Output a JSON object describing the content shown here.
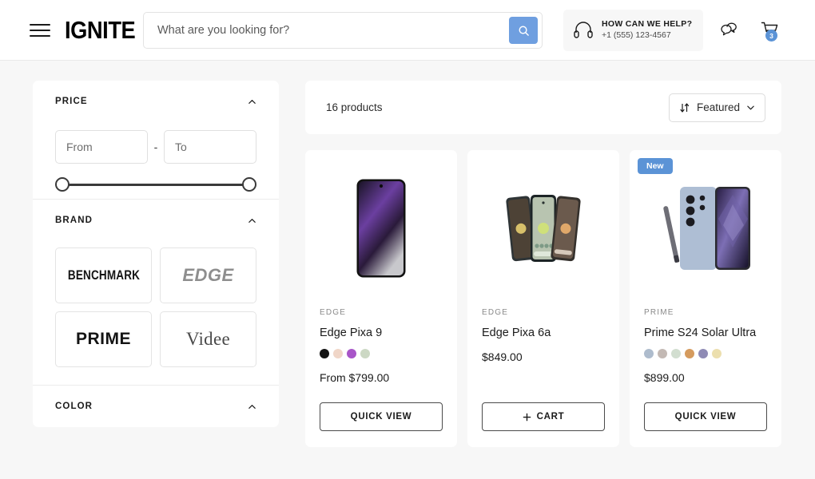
{
  "header": {
    "menu_icon": "hamburger-menu-icon",
    "logo": "IGNITE",
    "search": {
      "placeholder": "What are you looking for?",
      "value": "",
      "button_icon": "search-icon",
      "button_color": "#6f9fe0"
    },
    "help": {
      "icon": "headset-icon",
      "title": "HOW CAN WE HELP?",
      "phone": "+1 (555) 123-4567"
    },
    "chat_icon": "chat-bubble-icon",
    "cart_icon": "shopping-cart-icon",
    "cart_count": "3",
    "cart_badge_color": "#5b93d6"
  },
  "sidebar": {
    "filters": [
      {
        "title": "PRICE",
        "collapse_icon": "chevron-up-icon",
        "from_placeholder": "From",
        "from_value": "",
        "to_placeholder": "To",
        "to_value": "",
        "separator": "-"
      },
      {
        "title": "BRAND",
        "collapse_icon": "chevron-up-icon",
        "brands": [
          {
            "label": "BENCHMARK",
            "style": "condensed-bold"
          },
          {
            "label": "EDGE",
            "style": "italic-gray"
          },
          {
            "label": "PRIME",
            "style": "bold"
          },
          {
            "label": "Videe",
            "style": "serif"
          }
        ]
      },
      {
        "title": "COLOR",
        "collapse_icon": "chevron-up-icon"
      }
    ]
  },
  "toolbar": {
    "product_count": "16 products",
    "sort": {
      "icon": "sort-arrows-icon",
      "label": "Featured",
      "chevron": "chevron-down-icon"
    }
  },
  "products": [
    {
      "badge": "",
      "brand": "EDGE",
      "name": "Edge Pixa 9",
      "price": "From $799.00",
      "swatches": [
        "#141414",
        "#f0d6c8",
        "#a855c8",
        "#ccd8c4"
      ],
      "button": "QUICK VIEW",
      "button_icon": "",
      "image": "black-phone-purple-crystal-wallpaper"
    },
    {
      "badge": "",
      "brand": "EDGE",
      "name": "Edge Pixa 6a",
      "price": "$849.00",
      "swatches": [],
      "button": "CART",
      "button_icon": "plus-icon",
      "image": "three-phones-fanned-dark-sage-charcoal"
    },
    {
      "badge": "New",
      "brand": "PRIME",
      "name": "Prime S24 Solar Ultra",
      "price": "$899.00",
      "swatches": [
        "#aebccd",
        "#c3b9b4",
        "#d2ded0",
        "#d59b5e",
        "#8f8bb5",
        "#ecdfae"
      ],
      "button": "QUICK VIEW",
      "button_icon": "",
      "image": "two-phones-with-stylus-purple-geometric"
    }
  ]
}
